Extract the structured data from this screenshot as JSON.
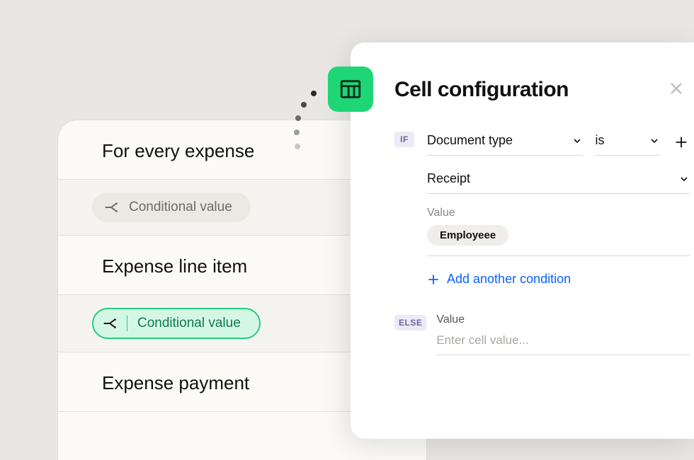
{
  "left": {
    "section1_title": "For every expense",
    "pill1_label": "Conditional value",
    "section2_title": "Expense line item",
    "pill2_label": "Conditional value",
    "section3_title": "Expense payment"
  },
  "panel": {
    "title": "Cell configuration",
    "if_tag": "IF",
    "else_tag": "ELSE",
    "field_select": "Document type",
    "operator_select": "is",
    "value_select": "Receipt",
    "value_label": "Value",
    "value_chip": "Employeee",
    "add_condition": "Add another condition",
    "else_value_label": "Value",
    "else_placeholder": "Enter cell value..."
  },
  "colors": {
    "accent_green": "#1ed676",
    "link_blue": "#0a62ff"
  }
}
